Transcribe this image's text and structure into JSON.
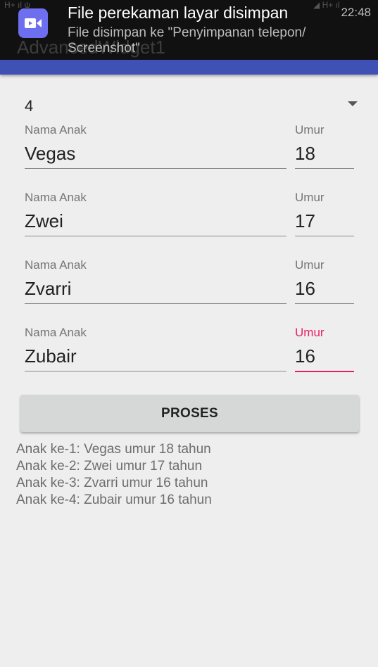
{
  "notification": {
    "title": "File perekaman layar disimpan",
    "time": "22:48",
    "body": "File disimpan ke \"Penyimpanan telepon/ Screenshot\"",
    "icon": "video-camera-icon",
    "icon_color": "#6d6ef0"
  },
  "appbar": {
    "title": "AdvancedWidget1",
    "color": "#3f51b5"
  },
  "spinner": {
    "selected": "4"
  },
  "labels": {
    "name": "Nama Anak",
    "age": "Umur"
  },
  "children": [
    {
      "name": "Vegas",
      "age": "18"
    },
    {
      "name": "Zwei",
      "age": "17"
    },
    {
      "name": "Zvarri",
      "age": "16"
    },
    {
      "name": "Zubair",
      "age": "16"
    }
  ],
  "accent_color": "#e91e63",
  "button": {
    "label": "PROSES"
  },
  "results": [
    "Anak ke-1: Vegas umur 18 tahun",
    "Anak ke-2: Zwei umur 17 tahun",
    "Anak ke-3: Zvarri umur 16 tahun",
    "Anak ke-4: Zubair umur 16 tahun"
  ]
}
